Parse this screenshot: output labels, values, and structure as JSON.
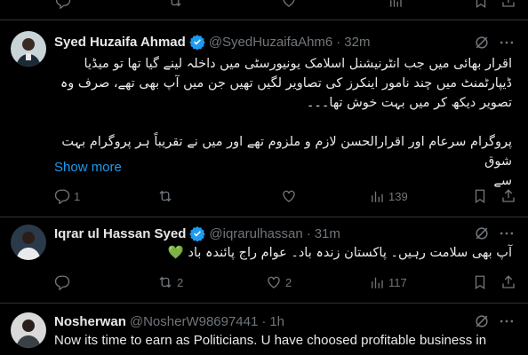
{
  "tweets": [
    {
      "name": "Syed Huzaifa Ahmad",
      "handle": "@SyedHuzaifaAhm6",
      "sep": "·",
      "time": "32m",
      "text_lines": [
        "اقرار بھائی میں جب انٹرنیشنل اسلامک یونیورسٹی میں داخلہ لینے گیا تھا تو میڈیا",
        "ڈیپارٹمنٹ میں چند نامور اینکرز کی تصاویر لگیں تھیں جن میں آپ بھی تھے، صرف وہ",
        "تصویر دیکھ کر میں بہت خوش تھا۔۔۔",
        "",
        "پروگرام سرعام اور اقرارالحسن لازم و ملزوم تھے اور میں نے تقریباً ہر پروگرام بہت شوق",
        "سے"
      ],
      "show_more": "Show more",
      "replies": "1",
      "reposts": "",
      "likes": "",
      "views": "139"
    },
    {
      "name": "Iqrar ul Hassan Syed",
      "handle": "@iqrarulhassan",
      "sep": "·",
      "time": "31m",
      "text_lines": [
        "آپ بھی سلامت رہیں۔ پاکستان زندہ باد۔ عوام راج پائندہ باد 💚"
      ],
      "replies": "",
      "reposts": "2",
      "likes": "2",
      "views": "117"
    },
    {
      "name": "Nosherwan",
      "handle": "@NosherW98697441",
      "sep": "·",
      "time": "1h",
      "text": "Now its time to earn as Politicians. U have choosed profitable business in"
    }
  ],
  "colors": {
    "background": "#000000",
    "text": "#e7e9ea",
    "muted": "#71767b",
    "accent": "#1d9bf0",
    "verified": "#1d9bf0",
    "border": "#2f3336"
  }
}
